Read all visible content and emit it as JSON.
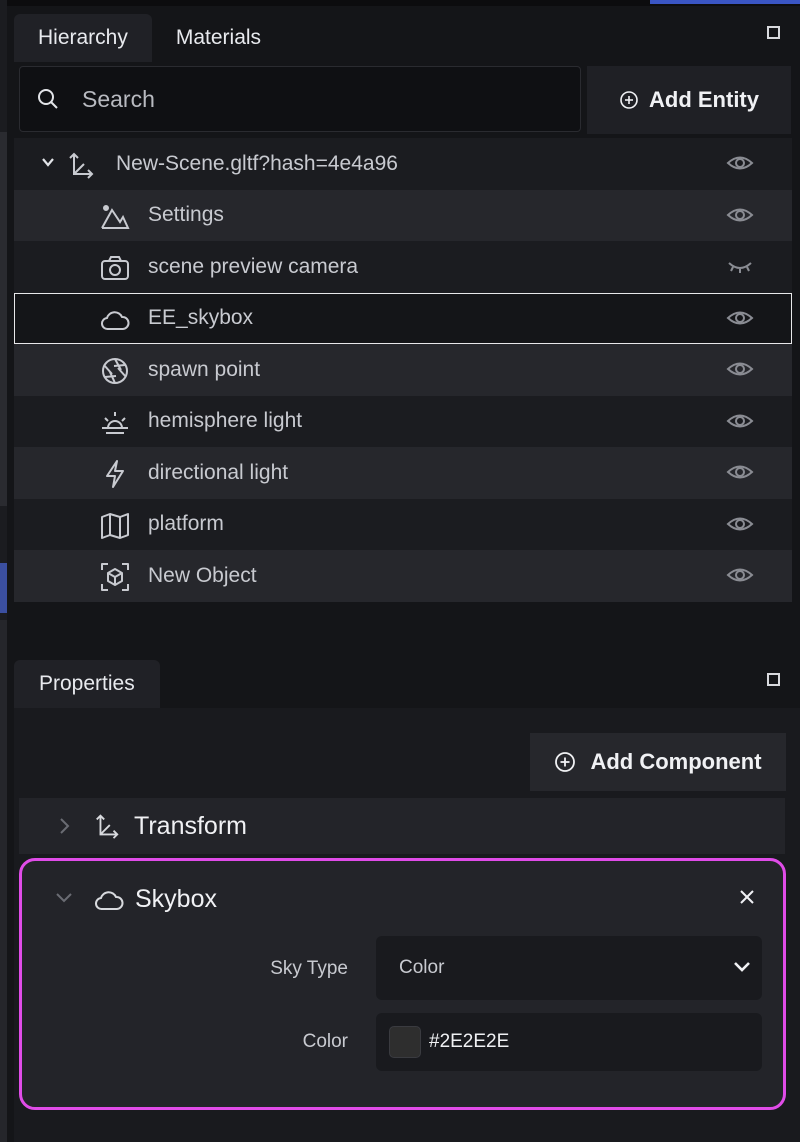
{
  "hierarchy": {
    "tabs": [
      {
        "label": "Hierarchy",
        "active": true
      },
      {
        "label": "Materials",
        "active": false
      }
    ],
    "search_placeholder": "Search",
    "add_entity_label": "Add Entity",
    "tree": [
      {
        "label": "New-Scene.gltf?hash=4e4a96",
        "icon": "axes-icon",
        "root": true,
        "expanded": true,
        "visible": true
      },
      {
        "label": "Settings",
        "icon": "mountain-icon",
        "visible": true
      },
      {
        "label": "scene preview camera",
        "icon": "camera-icon",
        "visible": false
      },
      {
        "label": "EE_skybox",
        "icon": "cloud-icon",
        "visible": true,
        "selected": true
      },
      {
        "label": "spawn point",
        "icon": "aperture-icon",
        "visible": true
      },
      {
        "label": "hemisphere light",
        "icon": "sunrise-icon",
        "visible": true
      },
      {
        "label": "directional light",
        "icon": "lightning-icon",
        "visible": true
      },
      {
        "label": "platform",
        "icon": "map-icon",
        "visible": true
      },
      {
        "label": "New Object",
        "icon": "box-icon",
        "visible": true
      }
    ]
  },
  "properties": {
    "tab_label": "Properties",
    "add_component_label": "Add Component",
    "components": {
      "transform": {
        "title": "Transform",
        "expanded": false
      },
      "skybox": {
        "title": "Skybox",
        "expanded": true,
        "sky_type_label": "Sky Type",
        "sky_type_value": "Color",
        "color_label": "Color",
        "color_value": "#2E2E2E"
      }
    }
  },
  "colors": {
    "highlight_border": "#e04ce8",
    "swatch": "#2E2E2E"
  }
}
